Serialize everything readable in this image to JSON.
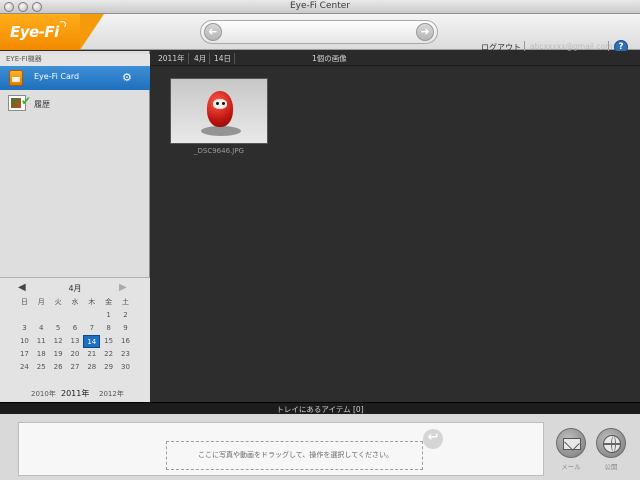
{
  "window": {
    "title": "Eye-Fi Center"
  },
  "header": {
    "logo": "Eye-Fi",
    "back_glyph": "➜",
    "forward_glyph": "➜",
    "logout": "ログアウト",
    "email": "abcxxxxx@gmail.com",
    "help": "?"
  },
  "sidebar": {
    "section_title": "EYE-FI機器",
    "items": [
      {
        "label": "Eye-Fi Card",
        "selected": true,
        "icon": "eyefi-card-icon"
      },
      {
        "label": "履歴",
        "selected": false,
        "icon": "history-icon"
      }
    ]
  },
  "breadcrumb": {
    "year": "2011年",
    "month": "4月",
    "day": "14日",
    "count": "1個の画像"
  },
  "gallery": {
    "photos": [
      {
        "filename": "_DSC9646.JPG"
      }
    ]
  },
  "calendar": {
    "month": "4月",
    "weekdays": [
      "日",
      "月",
      "火",
      "水",
      "木",
      "金",
      "土"
    ],
    "weeks": [
      [
        "",
        "",
        "",
        "",
        "",
        "1",
        "2"
      ],
      [
        "3",
        "4",
        "5",
        "6",
        "7",
        "8",
        "9"
      ],
      [
        "10",
        "11",
        "12",
        "13",
        "14",
        "15",
        "16"
      ],
      [
        "17",
        "18",
        "19",
        "20",
        "21",
        "22",
        "23"
      ],
      [
        "24",
        "25",
        "26",
        "27",
        "28",
        "29",
        "30"
      ]
    ],
    "selected_day": "14",
    "years": {
      "prev": "2010年",
      "current": "2011年",
      "next": "2012年"
    }
  },
  "tray": {
    "title": "トレイにあるアイテム [0]",
    "drop_hint": "ここに写真や動画をドラッグして、操作を選択してください。",
    "mail_label": "メール",
    "publish_label": "公開"
  },
  "colors": {
    "accent": "#1f6fbd",
    "brand_orange": "#f28900"
  }
}
